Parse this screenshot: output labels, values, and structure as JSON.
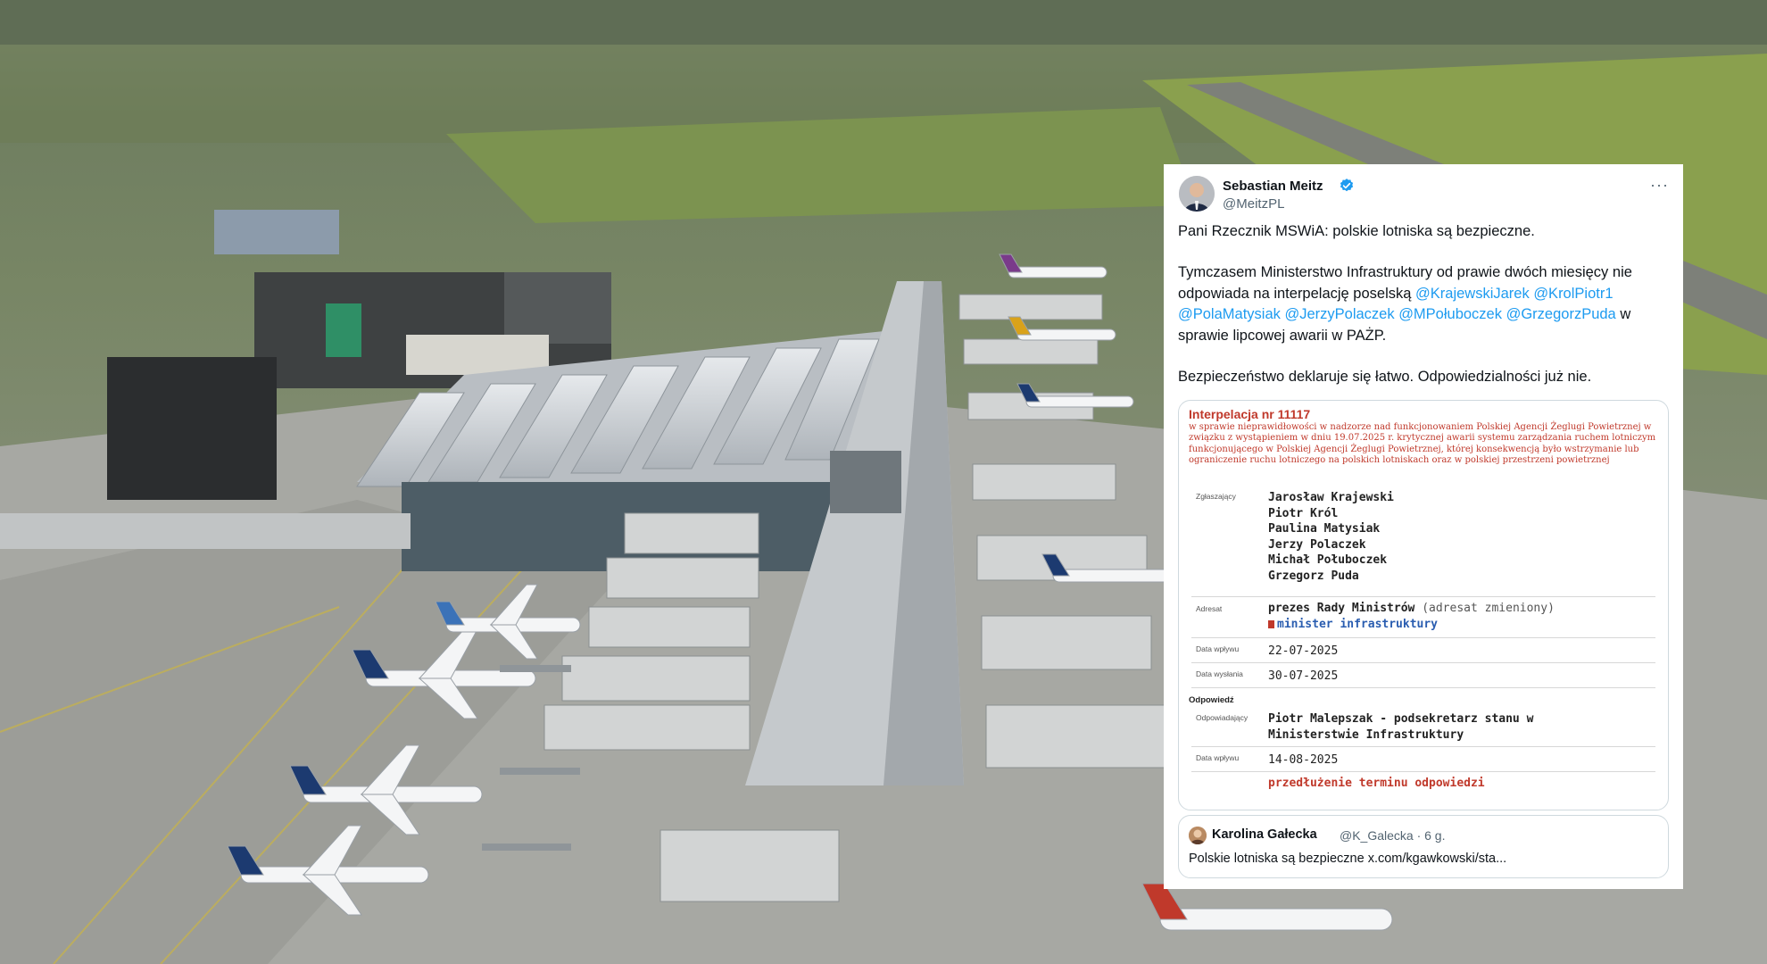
{
  "tweet": {
    "author_name": "Sebastian Meitz",
    "author_handle": "@MeitzPL",
    "more_label": "···",
    "body": {
      "p1": "Pani Rzecznik MSWiA: polskie lotniska są bezpieczne.",
      "p2_pre": "Tymczasem Ministerstwo Infrastruktury od prawie dwóch miesięcy nie odpowiada na interpelację poselską ",
      "mentions": [
        "@KrajewskiJarek",
        "@KrolPiotr1",
        "@PolaMatysiak",
        "@JerzyPolaczek",
        "@MPołuboczek",
        "@GrzegorzPuda"
      ],
      "p2_post": " w sprawie lipcowej awarii w PAŻP.",
      "p3": "Bezpieczeństwo deklaruje się łatwo. Odpowiedzialności już nie."
    }
  },
  "document": {
    "title": "Interpelacja nr 11117",
    "description": "w sprawie nieprawidłowości w nadzorze nad funkcjonowaniem Polskiej Agencji Żeglugi Powietrznej w związku z wystąpieniem w dniu 19.07.2025 r. krytycznej awarii systemu zarządzania ruchem lotniczym funkcjonującego w Polskiej Agencji Żeglugi Powietrznej, której konsekwencją było wstrzymanie lub ograniczenie ruchu lotniczego na polskich lotniskach oraz w polskiej przestrzeni powietrznej",
    "submitters_label": "Zgłaszający",
    "submitters": [
      "Jarosław Krajewski",
      "Piotr Król",
      "Paulina Matysiak",
      "Jerzy Polaczek",
      "Michał Połuboczek",
      "Grzegorz Puda"
    ],
    "addressee_label": "Adresat",
    "addressee": "prezes Rady Ministrów",
    "addressee_note": "(adresat zmieniony)",
    "addressee_new": "minister infrastruktury",
    "received_label": "Data wpływu",
    "received": "22-07-2025",
    "sent_label": "Data wysłania",
    "sent": "30-07-2025",
    "answer_section": "Odpowiedź",
    "responder_label": "Odpowiadający",
    "responder_line1": "Piotr Malepszak - podsekretarz stanu w",
    "responder_line2": "Ministerstwie Infrastruktury",
    "answer_received_label": "Data wpływu",
    "answer_received": "14-08-2025",
    "extension": "przedłużenie terminu odpowiedzi"
  },
  "quote": {
    "author_name": "Karolina Gałecka",
    "author_meta": "@K_Galecka · 6 g.",
    "text": "Polskie lotniska są bezpieczne x.com/kgawkowski/sta..."
  },
  "colors": {
    "link_blue": "#1d9bf0",
    "doc_red": "#c0392b",
    "verified_blue": "#1d9bf0"
  }
}
